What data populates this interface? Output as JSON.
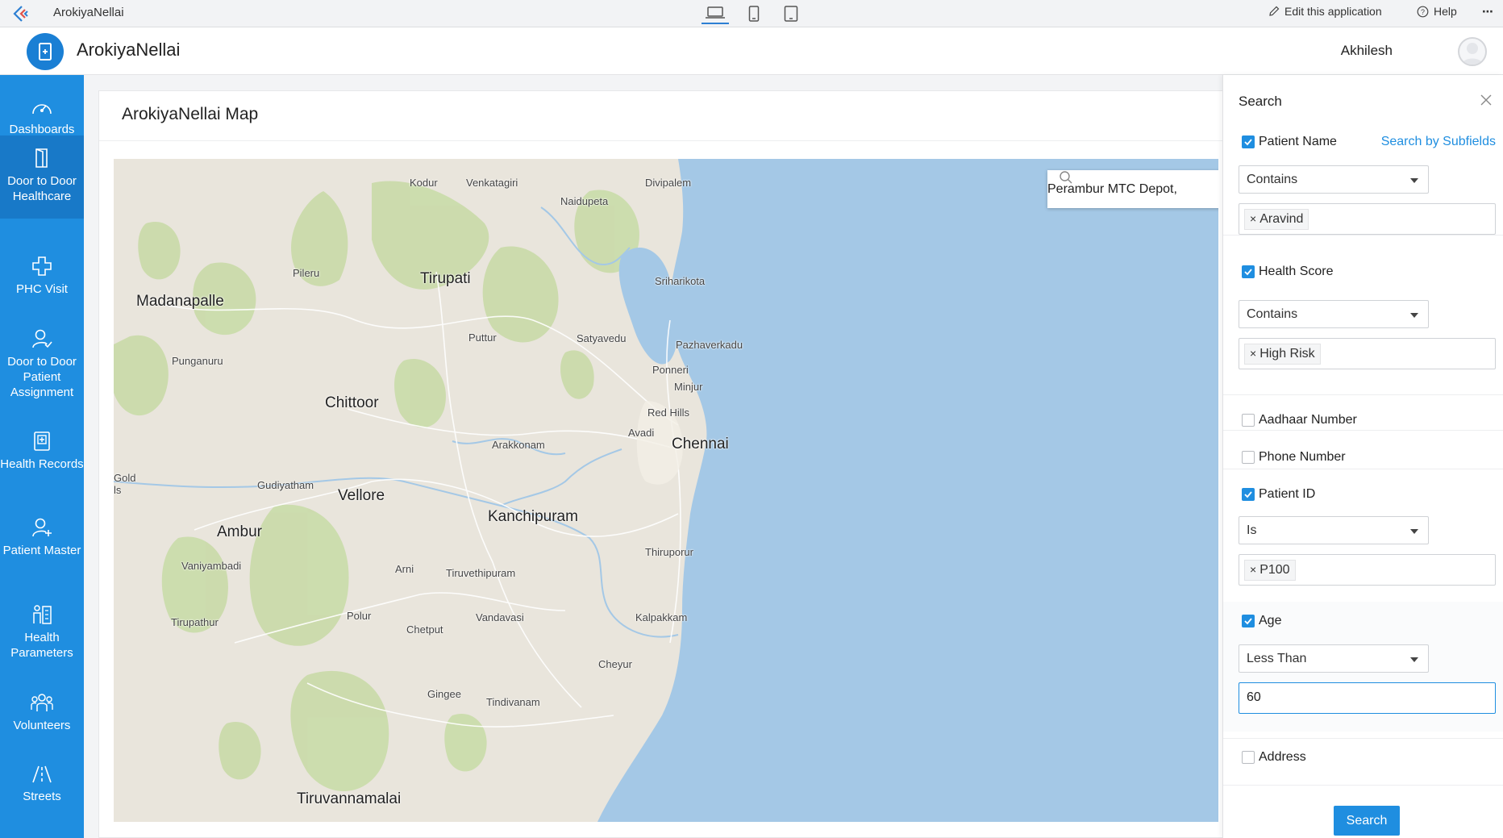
{
  "topbar": {
    "app_name": "ArokiyaNellai",
    "edit_label": "Edit this application",
    "help_label": "Help",
    "more_label": "⋯"
  },
  "header": {
    "brand": "ArokiyaNellai",
    "user": "Akhilesh"
  },
  "sidebar": {
    "items": [
      {
        "label": "Dashboards",
        "icon": "dashboard-icon"
      },
      {
        "label": "Door to Door Healthcare",
        "icon": "door-icon"
      },
      {
        "label": "PHC Visit",
        "icon": "plus-icon"
      },
      {
        "label": "Door to Door Patient Assignment",
        "icon": "user-assign-icon"
      },
      {
        "label": "Health Records",
        "icon": "records-icon"
      },
      {
        "label": "Patient Master",
        "icon": "user-add-icon"
      },
      {
        "label": "Health Parameters",
        "icon": "parameters-icon"
      },
      {
        "label": "Volunteers",
        "icon": "group-icon"
      },
      {
        "label": "Streets",
        "icon": "road-icon"
      }
    ]
  },
  "main": {
    "title": "ArokiyaNellai Map",
    "map_search": "Perambur MTC Depot,",
    "map_labels": {
      "madanapalle": "Madanapalle",
      "tirupati": "Tirupati",
      "chittoor": "Chittoor",
      "vellore": "Vellore",
      "ambur": "Ambur",
      "kanchipuram": "Kanchipuram",
      "chennai": "Chennai",
      "tiruvannamalai": "Tiruvannamalai",
      "kodur": "Kodur",
      "venkatagiri": "Venkatagiri",
      "naidupeta": "Naidupeta",
      "divipalem": "Divipalem",
      "pileru": "Pileru",
      "sriharikota": "Sriharikota",
      "puttur": "Puttur",
      "satyavedu": "Satyavedu",
      "pazhaverkadu": "Pazhaverkadu",
      "punganuru": "Punganuru",
      "ponneri": "Ponneri",
      "minjur": "Minjur",
      "red_hills": "Red Hills",
      "avadi": "Avadi",
      "arakkonam": "Arakkonam",
      "gudiyatham": "Gudiyatham",
      "vaniyambadi": "Vaniyambadi",
      "arni": "Arni",
      "tiruvethipuram": "Tiruvethipuram",
      "thiruporur": "Thiruporur",
      "tirupathur": "Tirupathur",
      "polur": "Polur",
      "chetput": "Chetput",
      "vandavasi": "Vandavasi",
      "kalpakkam": "Kalpakkam",
      "cheyur": "Cheyur",
      "gingee": "Gingee",
      "tindivanam": "Tindivanam",
      "kolar_partial": "Gold\nls"
    }
  },
  "panel": {
    "title": "Search",
    "search_by_subfields": "Search by Subfields",
    "fields": {
      "patient_name": {
        "label": "Patient Name",
        "checked": true,
        "operator": "Contains",
        "tag": "Aravind"
      },
      "health_score": {
        "label": "Health Score",
        "checked": true,
        "operator": "Contains",
        "tag": "High Risk"
      },
      "aadhaar": {
        "label": "Aadhaar Number",
        "checked": false
      },
      "phone": {
        "label": "Phone Number",
        "checked": false
      },
      "patient_id": {
        "label": "Patient ID",
        "checked": true,
        "operator": "Is",
        "tag": "P100"
      },
      "age": {
        "label": "Age",
        "checked": true,
        "operator": "Less Than",
        "value": "60"
      },
      "address": {
        "label": "Address",
        "checked": false
      }
    },
    "search_button": "Search"
  },
  "colors": {
    "accent": "#1f8ee0",
    "sidebar": "#1f8ee0",
    "sidebar_active": "#1879c8",
    "sea": "#a4c8e6",
    "land": "#e9e5dc",
    "forest": "#c9dba9"
  }
}
